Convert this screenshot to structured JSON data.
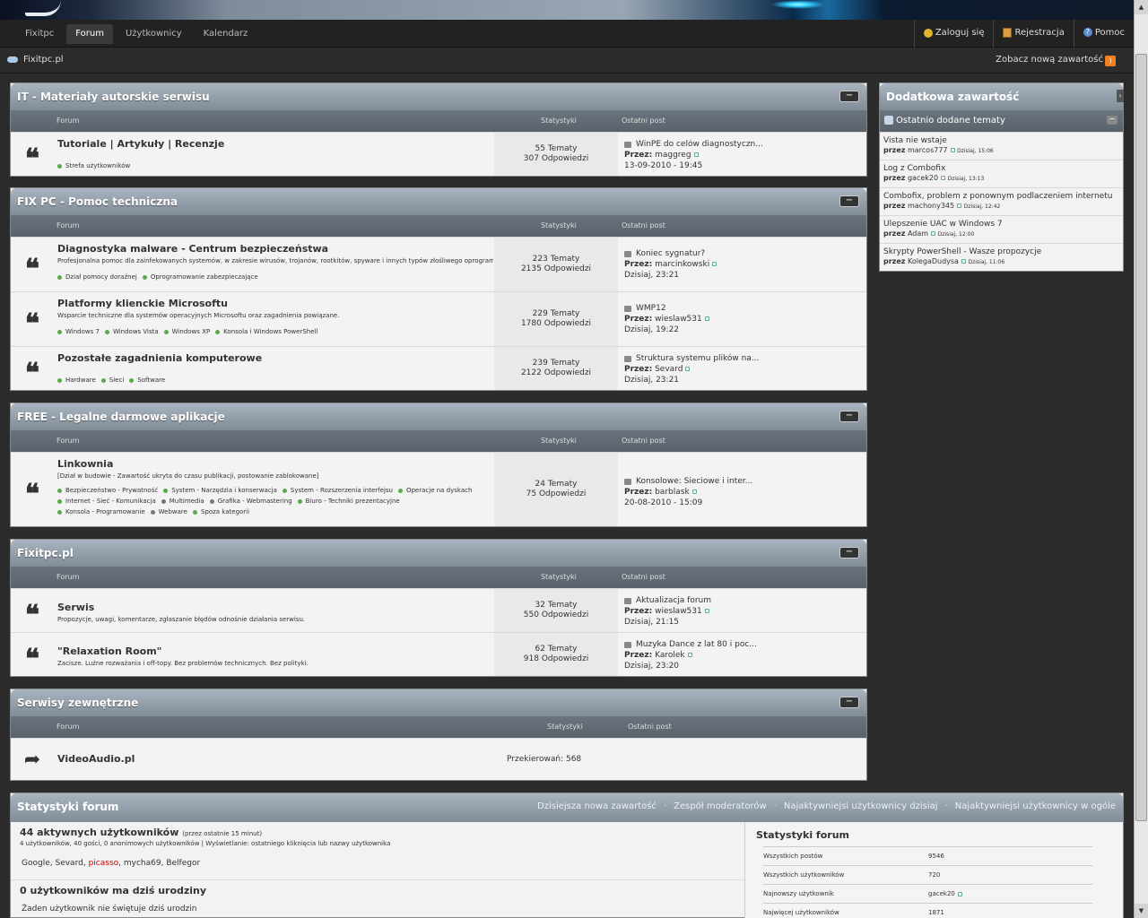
{
  "nav": {
    "tabs": [
      "Fixitpc",
      "Forum",
      "Użytkownicy",
      "Kalendarz"
    ],
    "active": "Forum",
    "user": {
      "login": "Zaloguj się",
      "register": "Rejestracja",
      "help": "Pomoc"
    }
  },
  "breadcrumb": {
    "site": "Fixitpc.pl",
    "new_content": "Zobacz nową zawartość"
  },
  "columns": {
    "forum": "Forum",
    "stats": "Statystyki",
    "last": "Ostatni post"
  },
  "labels": {
    "by": "Przez:",
    "collapse": "−"
  },
  "categories": [
    {
      "title": "IT - Materiały autorskie serwisu",
      "forums": [
        {
          "name": "Tutoriale | Artykuły | Recenzje",
          "desc": "",
          "subs": [
            "Strefa użytkowników"
          ],
          "topics": "55 Tematy",
          "replies": "307 Odpowiedzi",
          "last_title": "WinPE do celów diagnostyczn...",
          "last_user": "maggreg",
          "last_date": "13-09-2010 - 19:45"
        }
      ]
    },
    {
      "title": "FIX PC - Pomoc techniczna",
      "forums": [
        {
          "name": "Diagnostyka malware - Centrum bezpieczeństwa",
          "desc": "Profesjonalna pomoc dla zainfekowanych systemów, w zakresie wirusów, trojanów, rootkitów, spyware i innych typów złośliwego oprogramowania.",
          "subs": [
            "Dział pomocy doraźnej",
            "Oprogramowanie zabezpieczające"
          ],
          "topics": "223 Tematy",
          "replies": "2135 Odpowiedzi",
          "last_title": "Koniec sygnatur?",
          "last_user": "marcinkowski",
          "last_date": "Dzisiaj, 23:21"
        },
        {
          "name": "Platformy klienckie Microsoftu",
          "desc": "Wsparcie techniczne dla systemów operacyjnych Microsoftu oraz zagadnienia powiązane.",
          "subs": [
            "Windows 7",
            "Windows Vista",
            "Windows XP",
            "Konsola i Windows PowerShell"
          ],
          "topics": "229 Tematy",
          "replies": "1780 Odpowiedzi",
          "last_title": "WMP12",
          "last_user": "wieslaw531",
          "last_date": "Dzisiaj, 19:22"
        },
        {
          "name": "Pozostałe zagadnienia komputerowe",
          "desc": "",
          "subs": [
            "Hardware",
            "Sieci",
            "Software"
          ],
          "topics": "239 Tematy",
          "replies": "2122 Odpowiedzi",
          "last_title": "Struktura systemu plików na...",
          "last_user": "Sevard",
          "last_date": "Dzisiaj, 23:21"
        }
      ]
    },
    {
      "title": "FREE - Legalne darmowe aplikacje",
      "forums": [
        {
          "name": "Linkownia",
          "desc": "[Dział w budowie - Zawartość ukryta do czasu publikacji, postowanie zablokowane]",
          "subs": [
            "Bezpieczeństwo - Prywatność",
            "System - Narzędzia i konserwacja",
            "System - Rozszerzenia interfejsu",
            "Operacje na dyskach",
            "Internet - Sieć - Komunikacja",
            "Multimedia",
            "Grafika - Webmastering",
            "Biuro - Techniki prezentacyjne",
            "Konsola - Programowanie",
            "Webware",
            "Spoza kategorii"
          ],
          "topics": "24 Tematy",
          "replies": "75 Odpowiedzi",
          "last_title": "Konsolowe: Sieciowe i inter...",
          "last_user": "barblask",
          "last_date": "20-08-2010 - 15:09"
        }
      ]
    },
    {
      "title": "Fixitpc.pl",
      "forums": [
        {
          "name": "Serwis",
          "desc": "Propozycje, uwagi, komentarze, zgłaszanie błędów odnośnie działania serwisu.",
          "subs": [],
          "topics": "32 Tematy",
          "replies": "550 Odpowiedzi",
          "last_title": "Aktualizacja forum",
          "last_user": "wieslaw531",
          "last_date": "Dzisiaj, 21:15"
        },
        {
          "name": "\"Relaxation Room\"",
          "desc": "Zacisze. Luźne rozważania i off-topy. Bez problemów technicznych. Bez polityki.",
          "subs": [],
          "topics": "62 Tematy",
          "replies": "918 Odpowiedzi",
          "last_title": "Muzyka Dance z lat 80 i poc...",
          "last_user": "Karolek",
          "last_date": "Dzisiaj, 23:20"
        }
      ]
    },
    {
      "title": "Serwisy zewnętrzne",
      "redirect": {
        "name": "VideoAudio.pl",
        "count": "Przekierowań: 568"
      }
    }
  ],
  "side": {
    "title": "Dodatkowa zawartość",
    "section": "Ostatnio dodane tematy",
    "items": [
      {
        "title": "Vista nie wstaje",
        "by": "przez",
        "user": "marcos777",
        "date": "Dzisiaj, 15:06"
      },
      {
        "title": "Log z Combofix",
        "by": "przez",
        "user": "gacek20",
        "date": "Dzisiaj, 13:13"
      },
      {
        "title": "Combofix, problem z ponownym podlaczeniem internetu",
        "by": "przez",
        "user": "machony345",
        "date": "Dzisiaj, 12:42"
      },
      {
        "title": "Ulepszenie UAC w Windows 7",
        "by": "przez",
        "user": "Adam",
        "date": "Dzisiaj, 12:00"
      },
      {
        "title": "Skrypty PowerShell - Wasze propozycje",
        "by": "przez",
        "user": "KolegaDudysa",
        "date": "Dzisiaj, 11:06"
      }
    ]
  },
  "stats": {
    "title": "Statystyki forum",
    "links": [
      "Dzisiejsza nowa zawartość",
      "Zespół moderatorów",
      "Najaktywniejsi użytkownicy dzisiaj",
      "Najaktywniejsi użytkownicy w ogóle"
    ],
    "online_head": "44 aktywnych użytkowników",
    "online_note": "(przez ostatnie 15 minut)",
    "online_sub": "4 użytkowników, 40 gości, 0 anonimowych użytkowników | Wyświetlanie: ostatniego kliknięcia lub nazwy użytkownika",
    "online_users": [
      "Google",
      "Sevard",
      "picasso",
      "mycha69",
      "Belfegor"
    ],
    "bday_head": "0 użytkowników ma dziś urodziny",
    "bday_text": "Żaden użytkownik nie świętuje dziś urodzin",
    "right_title": "Statystyki forum",
    "rows": [
      {
        "k": "Wszystkich postów",
        "v": "9546"
      },
      {
        "k": "Wszystkich użytkowników",
        "v": "720"
      },
      {
        "k": "Najnowszy użytkownik",
        "v": "gacek20"
      },
      {
        "k": "Najwięcej użytkowników",
        "v": "1871"
      }
    ]
  }
}
